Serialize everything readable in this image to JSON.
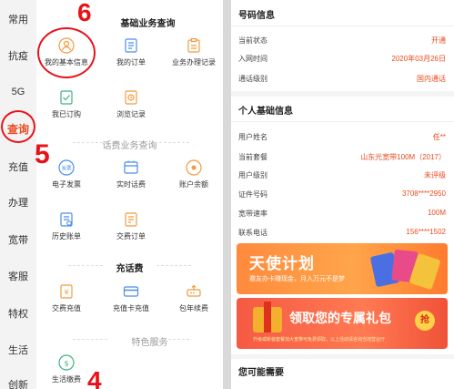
{
  "colors": {
    "accent": "#e94b1e",
    "annotation": "#e8121a"
  },
  "sidebar": {
    "items": [
      {
        "label": "常用"
      },
      {
        "label": "抗疫"
      },
      {
        "label": "5G"
      },
      {
        "label": "查询",
        "active": true
      },
      {
        "label": "充值"
      },
      {
        "label": "办理"
      },
      {
        "label": "宽带"
      },
      {
        "label": "客服"
      },
      {
        "label": "特权"
      },
      {
        "label": "生活"
      },
      {
        "label": "创新"
      }
    ]
  },
  "annotations": {
    "a6": "6",
    "a5": "5",
    "a4": "4"
  },
  "left": {
    "basic": {
      "title": "基础业务查询",
      "items": [
        {
          "label": "我的基本信息",
          "icon": "person-icon"
        },
        {
          "label": "我的订单",
          "icon": "order-icon"
        },
        {
          "label": "业务办理记录",
          "icon": "record-icon"
        },
        {
          "label": "我已订购",
          "icon": "subscribed-icon"
        },
        {
          "label": "浏览记录",
          "icon": "history-icon"
        }
      ]
    },
    "bill": {
      "title": "话费业务查询",
      "items": [
        {
          "label": "电子发票",
          "icon": "invoice-icon"
        },
        {
          "label": "实时话费",
          "icon": "realtime-bill-icon"
        },
        {
          "label": "账户余额",
          "icon": "balance-icon"
        },
        {
          "label": "历史账单",
          "icon": "bill-history-icon"
        },
        {
          "label": "交费订单",
          "icon": "payment-order-icon"
        }
      ]
    },
    "recharge": {
      "title": "充话费",
      "items": [
        {
          "label": "交费充值",
          "icon": "yuan-icon"
        },
        {
          "label": "充值卡充值",
          "icon": "card-icon"
        },
        {
          "label": "包年续费",
          "icon": "renew-icon"
        }
      ]
    },
    "special": {
      "title": "特色服务",
      "items": [
        {
          "label": "生活缴费",
          "icon": "life-payment-icon"
        }
      ]
    }
  },
  "right": {
    "number_info": {
      "title": "号码信息",
      "rows": [
        {
          "key": "当前状态",
          "value": "开通"
        },
        {
          "key": "入网时间",
          "value": "2020年03月26日"
        },
        {
          "key": "通话级别",
          "value": "国内通话"
        }
      ]
    },
    "personal_info": {
      "title": "个人基础信息",
      "rows": [
        {
          "key": "用户姓名",
          "value": "任**"
        },
        {
          "key": "当前套餐",
          "value": "山东光宽带100M（2017）"
        },
        {
          "key": "用户级别",
          "value": "未评级"
        },
        {
          "key": "证件号码",
          "value": "3708****2950"
        },
        {
          "key": "宽带速率",
          "value": "100M"
        },
        {
          "key": "联系电话",
          "value": "156****1502"
        }
      ]
    },
    "banner1": {
      "title": "天使计划",
      "subtitle": "邀友办卡赚现金，月入万元不是梦"
    },
    "banner2": {
      "title": "领取您的专属礼包",
      "subtitle": "升级或新装套餐加大宽带可免费领取，以上活动请咨询当地营业厅",
      "grab": "抢"
    },
    "maybe_need": {
      "title": "您可能需要"
    }
  }
}
